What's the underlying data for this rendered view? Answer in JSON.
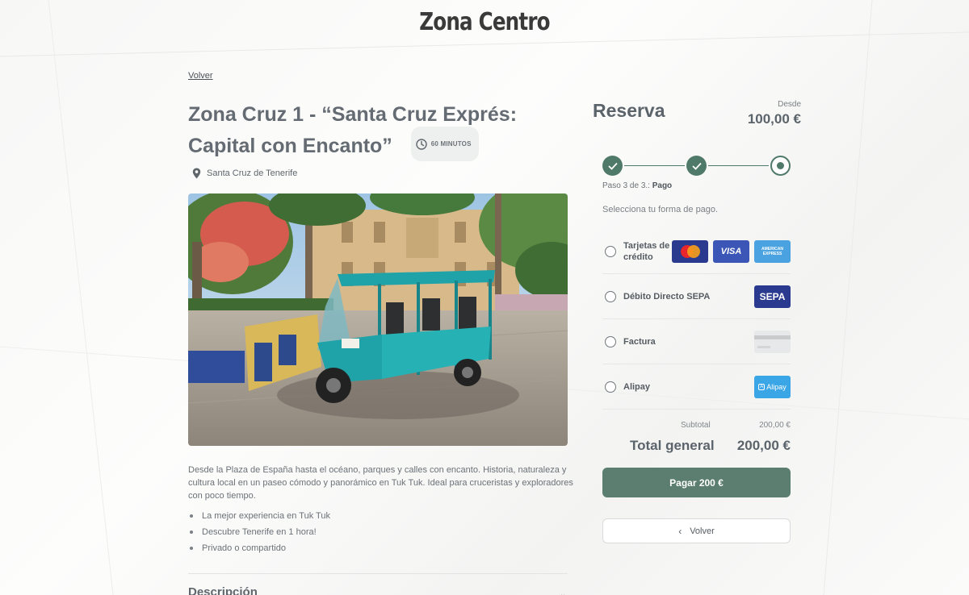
{
  "site": {
    "title": "Zona Centro"
  },
  "nav": {
    "back_link": "Volver"
  },
  "tour": {
    "title": "Zona Cruz 1 - “Santa Cruz Exprés: Capital con Encanto”",
    "duration": "60 MINUTOS",
    "location": "Santa Cruz de Tenerife",
    "description": "Desde la Plaza de España hasta el océano, parques y calles con encanto. Historia, naturaleza y cultura local en un paseo cómodo y panorámico en Tuk Tuk. Ideal para cruceristas y exploradores con poco tiempo.",
    "highlights": [
      "La mejor experiencia en Tuk Tuk",
      "Descubre Tenerife en 1 hora!",
      "Privado o compartido"
    ],
    "section_heading": "Descripción"
  },
  "booking": {
    "title": "Reserva",
    "from_label": "Desde",
    "from_price": "100,00 €",
    "step_prefix": "Paso 3 de 3.:",
    "step_name": "Pago",
    "instruction": "Selecciona tu forma de pago.",
    "payment_methods": [
      {
        "label": "Tarjetas de crédito",
        "icons": [
          "mastercard-icon",
          "visa-icon",
          "amex-icon"
        ]
      },
      {
        "label": "Débito Directo SEPA",
        "icons": [
          "sepa-icon"
        ]
      },
      {
        "label": "Factura",
        "icons": [
          "invoice-card-icon"
        ]
      },
      {
        "label": "Alipay",
        "icons": [
          "alipay-icon"
        ]
      }
    ],
    "card_text": {
      "visa": "VISA",
      "amex": "AMERICAN EXPRESS",
      "sepa": "SEPA",
      "alipay": "Alipay"
    },
    "subtotal_label": "Subtotal",
    "subtotal_value": "200,00 €",
    "total_label": "Total general",
    "total_value": "200,00 €",
    "pay_button": "Pagar 200 €",
    "back_button": "Volver"
  },
  "colors": {
    "accent": "#4f7a6a",
    "text": "#5b636b"
  }
}
